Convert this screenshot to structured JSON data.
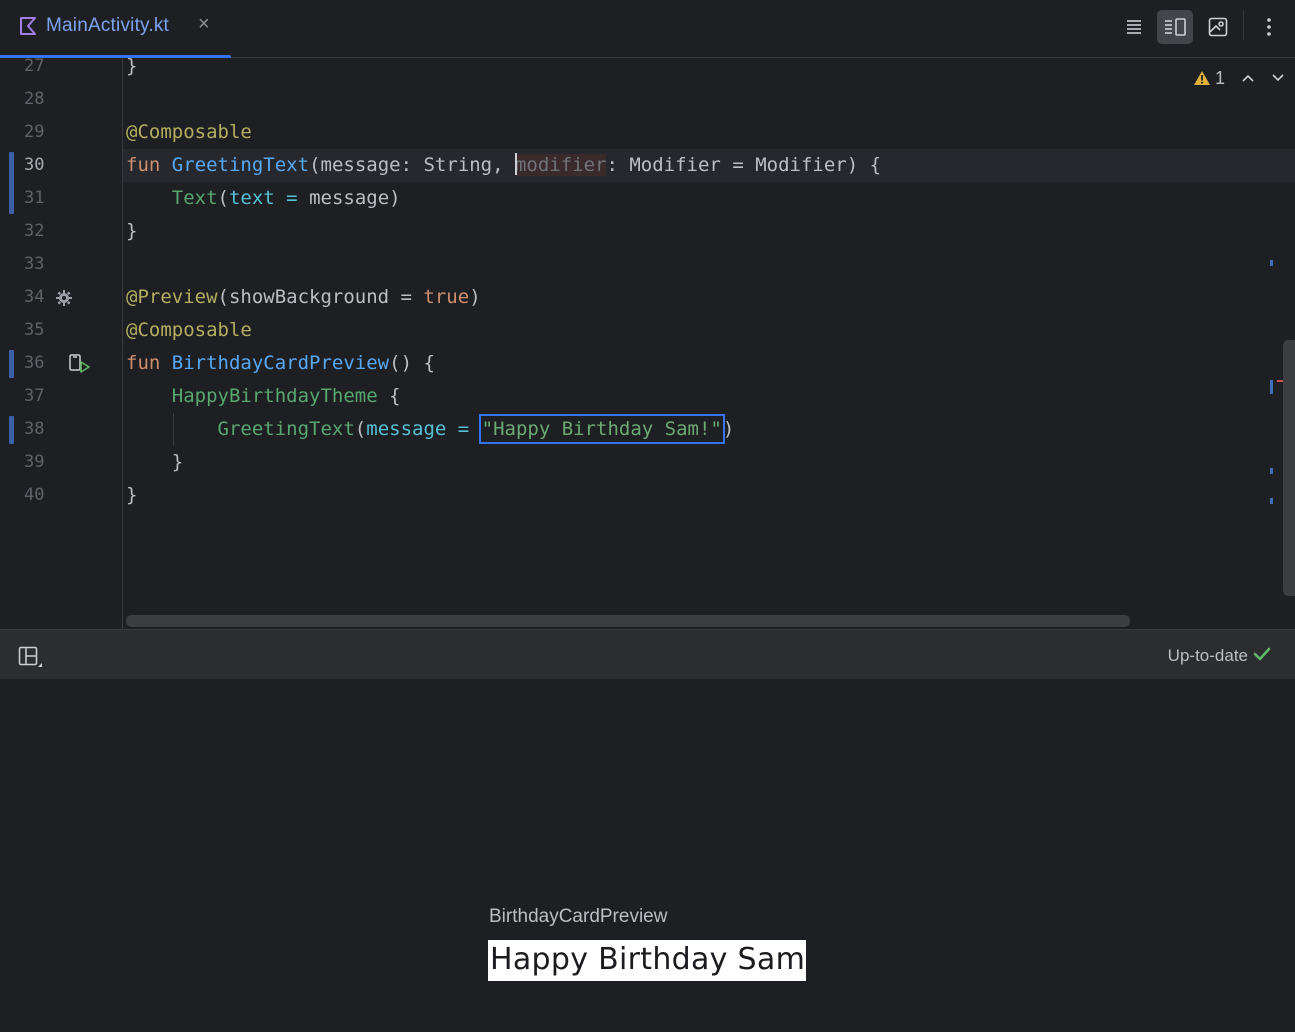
{
  "tab": {
    "filename": "MainActivity.kt",
    "close_glyph": "×"
  },
  "toolbar": {
    "icons": [
      "code-view-icon",
      "split-view-icon",
      "design-view-icon",
      "more-options-icon"
    ],
    "active": "split-view-icon"
  },
  "inspections": {
    "warning_count": "1"
  },
  "editor": {
    "current_line": "30",
    "line_numbers": [
      "27",
      "28",
      "29",
      "30",
      "31",
      "32",
      "33",
      "34",
      "35",
      "36",
      "37",
      "38",
      "39",
      "40"
    ],
    "code": {
      "l27": "}",
      "l29_annotation": "@Composable",
      "l30_kw": "fun",
      "l30_name": "GreetingText",
      "l30_params_a": "(message: String, ",
      "l30_unused": "modifier",
      "l30_params_b": ": Modifier = Modifier) {",
      "l31_call": "Text",
      "l31_open": "(",
      "l31_arg": "text =",
      "l31_rest": " message)",
      "l32": "}",
      "l34_annotation": "@Preview",
      "l34_open": "(showBackground = ",
      "l34_value": "true",
      "l34_close": ")",
      "l35_annotation": "@Composable",
      "l36_kw": "fun",
      "l36_name": "BirthdayCardPreview",
      "l36_rest": "() {",
      "l37_call": "HappyBirthdayTheme",
      "l37_rest": " {",
      "l38_call": "GreetingText",
      "l38_open": "(",
      "l38_arg": "message =",
      "l38_space": " ",
      "l38_string": "\"Happy Birthday Sam!\"",
      "l38_close": ")",
      "l39": "}",
      "l40": "}"
    }
  },
  "preview_bar": {
    "status": "Up-to-date"
  },
  "preview": {
    "name": "BirthdayCardPreview",
    "rendered_text": "Happy Birthday Sam!"
  },
  "colors": {
    "accent": "#3574f0",
    "background": "#1e1f22",
    "keyword": "#cf8e6d",
    "annotation": "#b3ae60",
    "string": "#6aab73",
    "success": "#5fb865"
  }
}
